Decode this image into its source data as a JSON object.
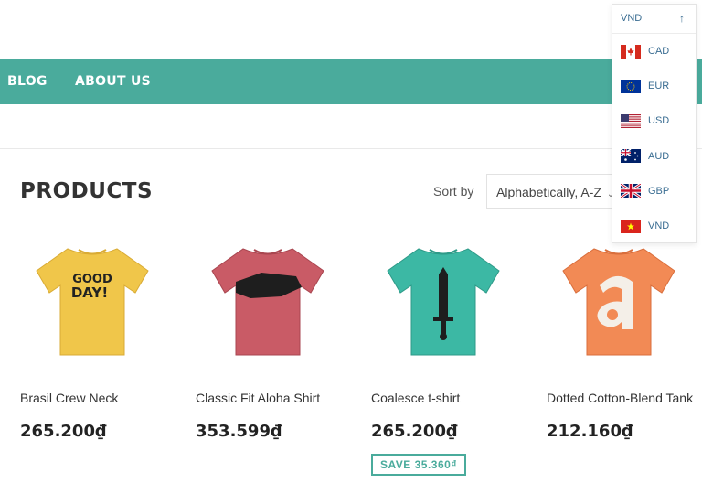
{
  "nav": {
    "blog_label": "BLOG",
    "about_label": "ABOUT US"
  },
  "page": {
    "title": "PRODUCTS"
  },
  "sort": {
    "label": "Sort by",
    "selected": "Alphabetically, A-Z"
  },
  "currency": {
    "current": "VND",
    "options": [
      {
        "code": "CAD",
        "flag": "canada-flag"
      },
      {
        "code": "EUR",
        "flag": "eu-flag"
      },
      {
        "code": "USD",
        "flag": "usa-flag"
      },
      {
        "code": "AUD",
        "flag": "australia-flag"
      },
      {
        "code": "GBP",
        "flag": "uk-flag"
      },
      {
        "code": "VND",
        "flag": "vietnam-flag"
      }
    ]
  },
  "products": [
    {
      "name": "Brasil Crew Neck",
      "price": "265.200₫",
      "shirt_color": "#f0c64a",
      "print": "GOOD DAY!"
    },
    {
      "name": "Classic Fit Aloha Shirt",
      "price": "353.599₫",
      "shirt_color": "#c95b66"
    },
    {
      "name": "Coalesce t-shirt",
      "price": "265.200₫",
      "shirt_color": "#3cb8a4",
      "save_label": "SAVE 35.360₫"
    },
    {
      "name": "Dotted Cotton-Blend Tank",
      "price": "212.160₫",
      "shirt_color": "#f28a55"
    }
  ],
  "colors": {
    "accent": "#4aab9c",
    "link": "#3a6d92"
  }
}
